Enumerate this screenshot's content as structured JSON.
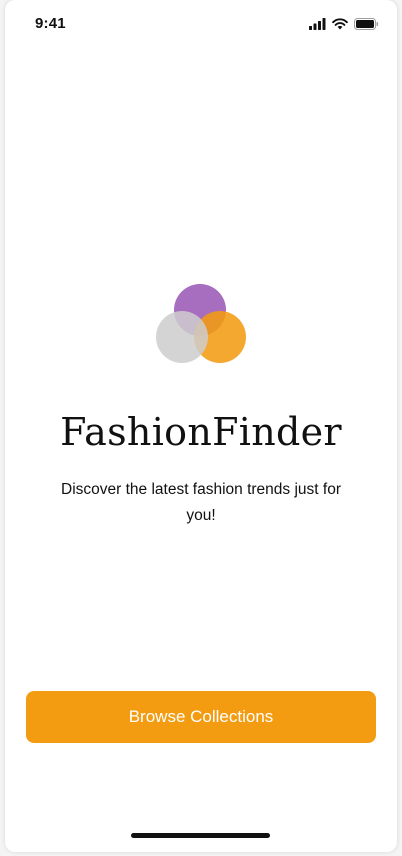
{
  "status_bar": {
    "time": "9:41",
    "icons": [
      "cellular-signal-icon",
      "wifi-icon",
      "battery-icon"
    ]
  },
  "logo": {
    "colors": {
      "purple": "#9b59b6",
      "orange": "#f39c12",
      "grey": "#cecccE"
    }
  },
  "app": {
    "title": "FashionFinder",
    "tagline": "Discover the latest fashion trends just for you!"
  },
  "cta": {
    "label": "Browse Collections",
    "color": "#f39c12"
  }
}
